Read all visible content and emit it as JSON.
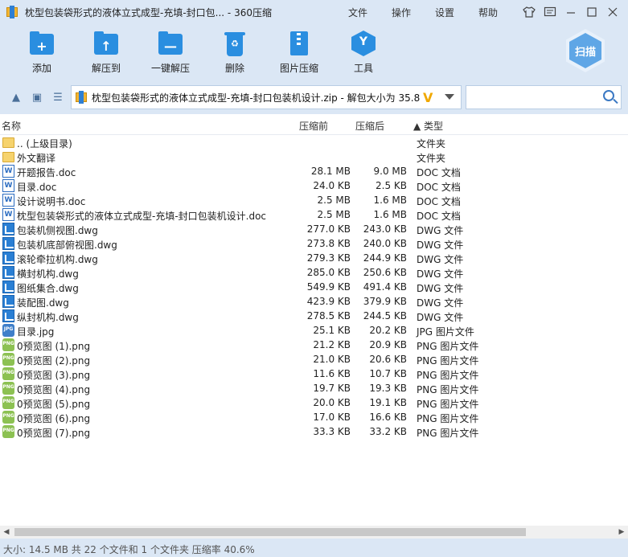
{
  "window": {
    "title": "枕型包装袋形式的液体立式成型-充填-封口包... - 360压缩",
    "menus": [
      "文件",
      "操作",
      "设置",
      "帮助"
    ]
  },
  "toolbar": {
    "buttons": [
      {
        "label": "添加",
        "icon": "add-folder-icon"
      },
      {
        "label": "解压到",
        "icon": "extract-folder-icon"
      },
      {
        "label": "一键解压",
        "icon": "one-click-extract-icon"
      },
      {
        "label": "删除",
        "icon": "trash-icon"
      },
      {
        "label": "图片压缩",
        "icon": "image-compress-icon"
      },
      {
        "label": "工具",
        "icon": "tools-icon"
      }
    ],
    "scan_label": "扫描"
  },
  "address": {
    "path": "枕型包装袋形式的液体立式成型-充填-封口包装机设计.zip - 解包大小为 35.8",
    "mark": "V"
  },
  "columns": {
    "name": "名称",
    "packed": "压缩前",
    "compressed": "压缩后",
    "type": "▲ 类型"
  },
  "files": [
    {
      "icon": "folder",
      "name": ".. (上级目录)",
      "size": "",
      "packed": "",
      "type": "文件夹"
    },
    {
      "icon": "folder",
      "name": "外文翻译",
      "size": "",
      "packed": "",
      "type": "文件夹"
    },
    {
      "icon": "doc",
      "name": "开题报告.doc",
      "size": "28.1 MB",
      "packed": "9.0 MB",
      "type": "DOC 文档"
    },
    {
      "icon": "doc",
      "name": "目录.doc",
      "size": "24.0 KB",
      "packed": "2.5 KB",
      "type": "DOC 文档"
    },
    {
      "icon": "doc",
      "name": "设计说明书.doc",
      "size": "2.5 MB",
      "packed": "1.6 MB",
      "type": "DOC 文档"
    },
    {
      "icon": "doc",
      "name": "枕型包装袋形式的液体立式成型-充填-封口包装机设计.doc",
      "size": "2.5 MB",
      "packed": "1.6 MB",
      "type": "DOC 文档"
    },
    {
      "icon": "dwg",
      "name": "包装机侧视图.dwg",
      "size": "277.0 KB",
      "packed": "243.0 KB",
      "type": "DWG 文件"
    },
    {
      "icon": "dwg",
      "name": "包装机底部俯视图.dwg",
      "size": "273.8 KB",
      "packed": "240.0 KB",
      "type": "DWG 文件"
    },
    {
      "icon": "dwg",
      "name": "滚轮牵拉机构.dwg",
      "size": "279.3 KB",
      "packed": "244.9 KB",
      "type": "DWG 文件"
    },
    {
      "icon": "dwg",
      "name": "横封机构.dwg",
      "size": "285.0 KB",
      "packed": "250.6 KB",
      "type": "DWG 文件"
    },
    {
      "icon": "dwg",
      "name": "图纸集合.dwg",
      "size": "549.9 KB",
      "packed": "491.4 KB",
      "type": "DWG 文件"
    },
    {
      "icon": "dwg",
      "name": "装配图.dwg",
      "size": "423.9 KB",
      "packed": "379.9 KB",
      "type": "DWG 文件"
    },
    {
      "icon": "dwg",
      "name": "纵封机构.dwg",
      "size": "278.5 KB",
      "packed": "244.5 KB",
      "type": "DWG 文件"
    },
    {
      "icon": "jpg",
      "name": "目录.jpg",
      "size": "25.1 KB",
      "packed": "20.2 KB",
      "type": "JPG 图片文件"
    },
    {
      "icon": "png",
      "name": "0预览图 (1).png",
      "size": "21.2 KB",
      "packed": "20.9 KB",
      "type": "PNG 图片文件"
    },
    {
      "icon": "png",
      "name": "0预览图 (2).png",
      "size": "21.0 KB",
      "packed": "20.6 KB",
      "type": "PNG 图片文件"
    },
    {
      "icon": "png",
      "name": "0预览图 (3).png",
      "size": "11.6 KB",
      "packed": "10.7 KB",
      "type": "PNG 图片文件"
    },
    {
      "icon": "png",
      "name": "0预览图 (4).png",
      "size": "19.7 KB",
      "packed": "19.3 KB",
      "type": "PNG 图片文件"
    },
    {
      "icon": "png",
      "name": "0预览图 (5).png",
      "size": "20.0 KB",
      "packed": "19.1 KB",
      "type": "PNG 图片文件"
    },
    {
      "icon": "png",
      "name": "0预览图 (6).png",
      "size": "17.0 KB",
      "packed": "16.6 KB",
      "type": "PNG 图片文件"
    },
    {
      "icon": "png",
      "name": "0预览图 (7).png",
      "size": "33.3 KB",
      "packed": "33.2 KB",
      "type": "PNG 图片文件"
    }
  ],
  "status": "大小: 14.5 MB 共 22 个文件和 1 个文件夹 压缩率 40.6%",
  "colors": {
    "accent": "#2a8ee0",
    "chrome": "#dbe7f5"
  }
}
